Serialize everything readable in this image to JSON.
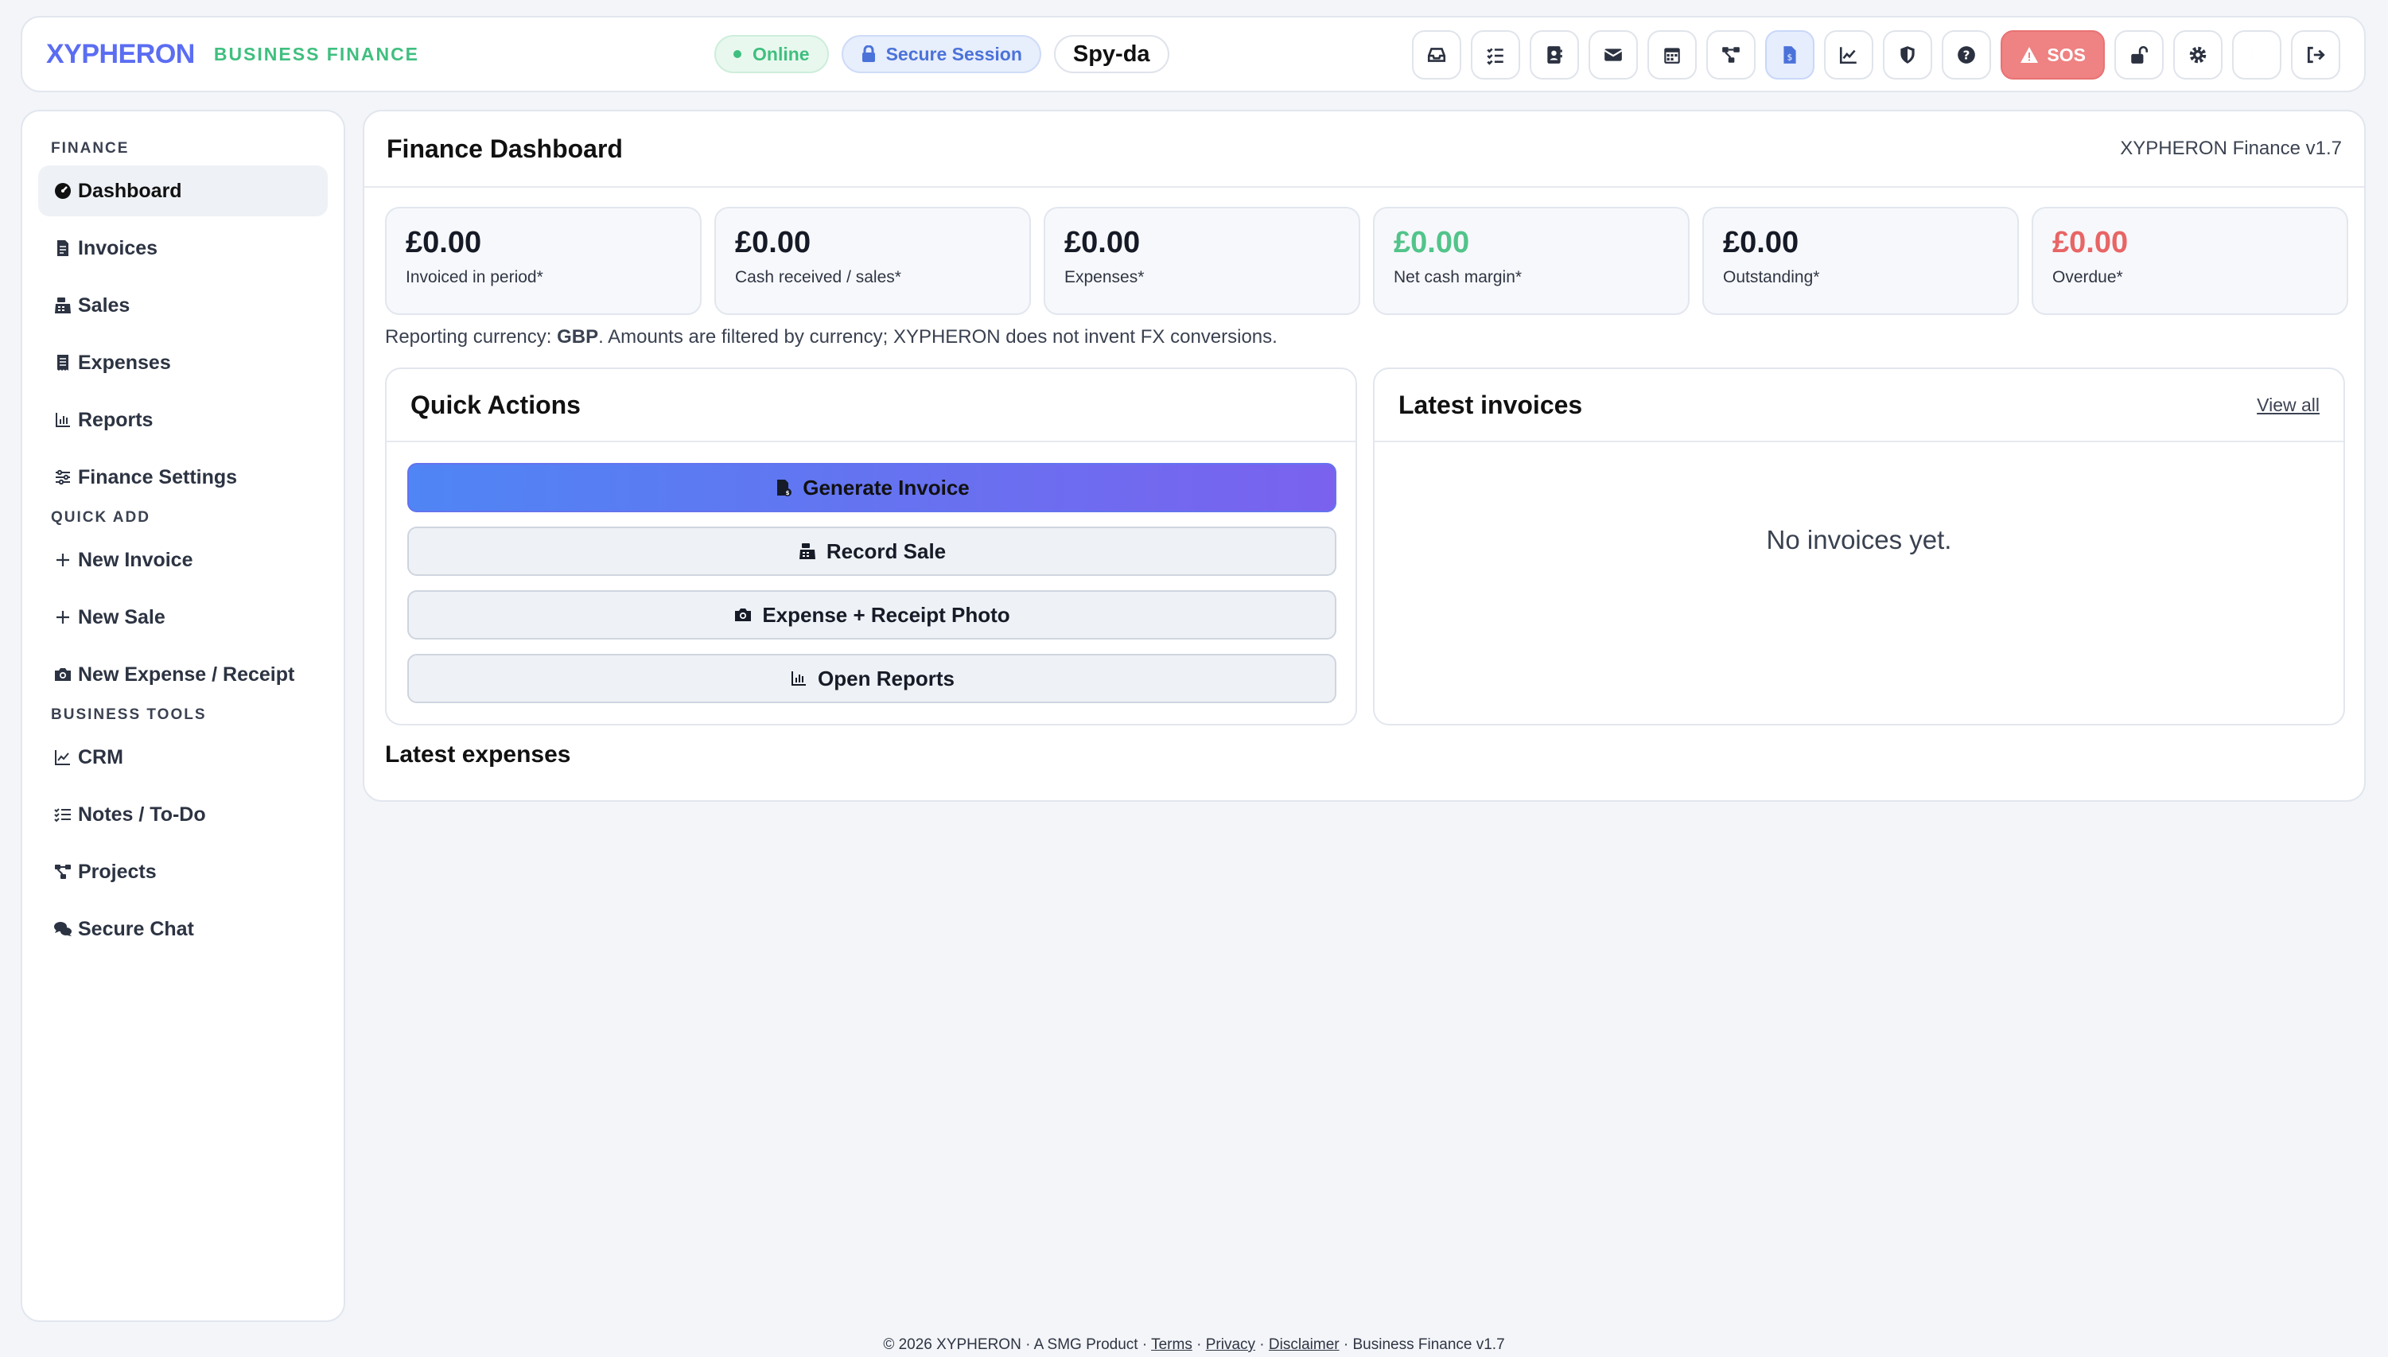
{
  "header": {
    "brand": "XYPHERON",
    "brand_sub": "BUSINESS FINANCE",
    "status_online": "Online",
    "status_secure": "Secure Session",
    "user": "Spy-da",
    "sos": "SOS",
    "icons": [
      "inbox-icon",
      "checklist-icon",
      "contacts-icon",
      "mail-icon",
      "calendar-icon",
      "projects-icon",
      "finance-icon",
      "chart-icon",
      "shield-icon",
      "help-icon",
      "unlock-icon",
      "settings-icon",
      "moon-icon",
      "logout-icon"
    ]
  },
  "sidebar": {
    "sections": [
      {
        "title": "FINANCE",
        "items": [
          {
            "label": "Dashboard",
            "icon": "dashboard-icon",
            "active": true
          },
          {
            "label": "Invoices",
            "icon": "invoice-icon"
          },
          {
            "label": "Sales",
            "icon": "cash-register-icon"
          },
          {
            "label": "Expenses",
            "icon": "receipt-icon"
          },
          {
            "label": "Reports",
            "icon": "chart-icon"
          },
          {
            "label": "Finance Settings",
            "icon": "sliders-icon"
          }
        ]
      },
      {
        "title": "QUICK ADD",
        "items": [
          {
            "label": "New Invoice",
            "icon": "plus-icon"
          },
          {
            "label": "New Sale",
            "icon": "plus-icon"
          },
          {
            "label": "New Expense / Receipt",
            "icon": "camera-icon"
          }
        ]
      },
      {
        "title": "BUSINESS TOOLS",
        "items": [
          {
            "label": "CRM",
            "icon": "line-chart-icon"
          },
          {
            "label": "Notes / To-Do",
            "icon": "checklist-icon"
          },
          {
            "label": "Projects",
            "icon": "projects-icon"
          },
          {
            "label": "Secure Chat",
            "icon": "chat-icon"
          }
        ]
      }
    ]
  },
  "main": {
    "title": "Finance Dashboard",
    "version": "XYPHERON Finance v1.7",
    "kpis": [
      {
        "value": "£0.00",
        "label": "Invoiced in period*"
      },
      {
        "value": "£0.00",
        "label": "Cash received / sales*"
      },
      {
        "value": "£0.00",
        "label": "Expenses*"
      },
      {
        "value": "£0.00",
        "label": "Net cash margin*"
      },
      {
        "value": "£0.00",
        "label": "Outstanding*"
      },
      {
        "value": "£0.00",
        "label": "Overdue*"
      }
    ],
    "currency_note_prefix": "Reporting currency: ",
    "currency_code": "GBP",
    "currency_note_suffix": ". Amounts are filtered by currency; XYPHERON does not invent FX conversions.",
    "quick_actions": {
      "title": "Quick Actions",
      "buttons": [
        "Generate Invoice",
        "Record Sale",
        "Expense + Receipt Photo",
        "Open Reports"
      ]
    },
    "latest_invoices": {
      "title": "Latest invoices",
      "view_all": "View all",
      "empty": "No invoices yet."
    },
    "latest_expenses_title": "Latest expenses"
  },
  "footer": {
    "copyright": "© 2026 XYPHERON · A SMG Product · ",
    "terms": "Terms",
    "privacy": "Privacy",
    "disclaimer": "Disclaimer",
    "suffix": " · Business Finance v1.7",
    "sep": " · "
  },
  "colors": {
    "accent": "#5b6df2",
    "success": "#3fbf7f",
    "danger": "#e86565",
    "sos": "#ef8282"
  }
}
